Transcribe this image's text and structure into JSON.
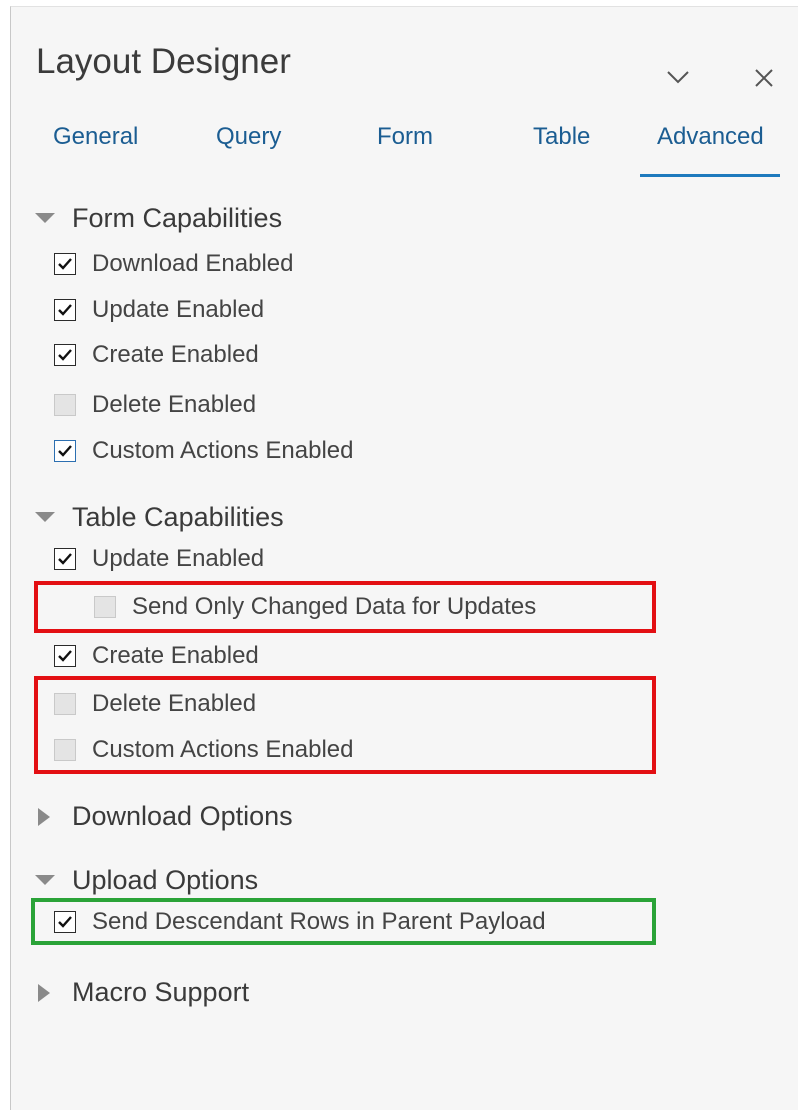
{
  "panel": {
    "title": "Layout Designer",
    "collapse_icon": "chevron-down-icon",
    "close_icon": "close-icon"
  },
  "tabs": [
    {
      "label": "General",
      "active": false
    },
    {
      "label": "Query",
      "active": false
    },
    {
      "label": "Form",
      "active": false
    },
    {
      "label": "Table",
      "active": false
    },
    {
      "label": "Advanced",
      "active": true
    }
  ],
  "colors": {
    "tab_text": "#1b5d92",
    "tab_underline": "#1e7abd",
    "highlight_red": "#e30f13",
    "highlight_green": "#2aa338",
    "panel_bg": "#f6f6f6"
  },
  "sections": {
    "form_capabilities": {
      "label": "Form Capabilities",
      "expanded": true,
      "options": [
        {
          "label": "Download Enabled",
          "checked": true,
          "enabled": true
        },
        {
          "label": "Update Enabled",
          "checked": true,
          "enabled": true
        },
        {
          "label": "Create Enabled",
          "checked": true,
          "enabled": true
        },
        {
          "label": "Delete Enabled",
          "checked": false,
          "enabled": false
        },
        {
          "label": "Custom Actions Enabled",
          "checked": true,
          "enabled": true
        }
      ]
    },
    "table_capabilities": {
      "label": "Table Capabilities",
      "expanded": true,
      "options": [
        {
          "label": "Update Enabled",
          "checked": true,
          "enabled": true
        },
        {
          "label": "Send Only Changed Data for Updates",
          "checked": false,
          "enabled": false
        },
        {
          "label": "Create Enabled",
          "checked": true,
          "enabled": true
        },
        {
          "label": "Delete Enabled",
          "checked": false,
          "enabled": false
        },
        {
          "label": "Custom Actions Enabled",
          "checked": false,
          "enabled": false
        }
      ]
    },
    "download_options": {
      "label": "Download Options",
      "expanded": false
    },
    "upload_options": {
      "label": "Upload Options",
      "expanded": true,
      "options": [
        {
          "label": "Send Descendant Rows in Parent Payload",
          "checked": true,
          "enabled": true
        }
      ]
    },
    "macro_support": {
      "label": "Macro Support",
      "expanded": false
    }
  }
}
